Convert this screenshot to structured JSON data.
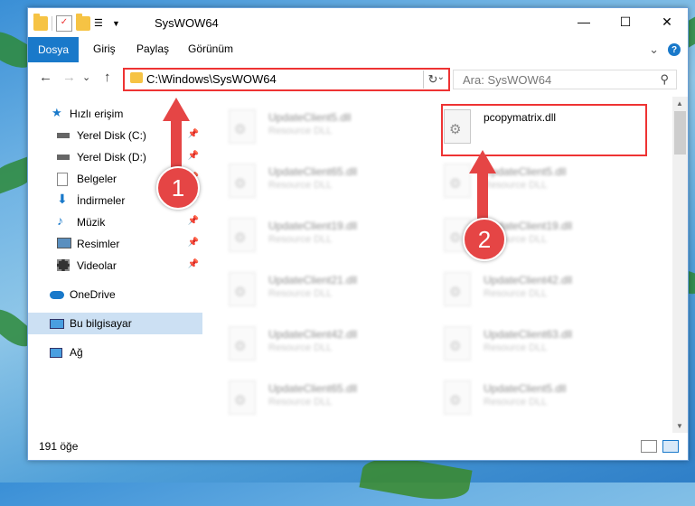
{
  "window": {
    "title": "SysWOW64",
    "min": "—",
    "max": "☐",
    "close": "✕"
  },
  "ribbon": {
    "tabs": [
      "Dosya",
      "Giriş",
      "Paylaş",
      "Görünüm"
    ],
    "expand": "⌄",
    "help": "?"
  },
  "nav": {
    "back": "←",
    "forward": "→",
    "history": "⌄",
    "up": "↑",
    "address": "C:\\Windows\\SysWOW64",
    "refresh": "↻",
    "search_placeholder": "Ara: SysWOW64",
    "search_icon": "⚲"
  },
  "sidebar": {
    "items": [
      {
        "label": "Hızlı erişim",
        "icon": "star-icon",
        "pinned": false
      },
      {
        "label": "Yerel Disk (C:)",
        "icon": "drive-icon",
        "pinned": true
      },
      {
        "label": "Yerel Disk (D:)",
        "icon": "drive-icon",
        "pinned": true
      },
      {
        "label": "Belgeler",
        "icon": "documents-icon",
        "pinned": true
      },
      {
        "label": "İndirmeler",
        "icon": "download-icon",
        "pinned": true
      },
      {
        "label": "Müzik",
        "icon": "music-icon",
        "pinned": true
      },
      {
        "label": "Resimler",
        "icon": "pictures-icon",
        "pinned": true
      },
      {
        "label": "Videolar",
        "icon": "videos-icon",
        "pinned": true
      },
      {
        "label": "OneDrive",
        "icon": "onedrive-icon",
        "pinned": false
      },
      {
        "label": "Bu bilgisayar",
        "icon": "computer-icon",
        "pinned": false
      },
      {
        "label": "Ağ",
        "icon": "network-icon",
        "pinned": false
      }
    ],
    "pin_glyph": "📌"
  },
  "files_left": [
    {
      "name": "UpdateClient5.dll",
      "type": "Resource DLL"
    },
    {
      "name": "UpdateClient65.dll",
      "type": "Resource DLL"
    },
    {
      "name": "UpdateClient19.dll",
      "type": "Resource DLL"
    },
    {
      "name": "UpdateClient21.dll",
      "type": "Resource DLL"
    },
    {
      "name": "UpdateClient42.dll",
      "type": "Resource DLL"
    },
    {
      "name": "UpdateClient65.dll",
      "type": "Resource DLL"
    }
  ],
  "files_right": [
    {
      "name": "pcopymatrix.dll",
      "type": ""
    },
    {
      "name": "UpdateClient5.dll",
      "type": "Resource DLL"
    },
    {
      "name": "UpdateClient19.dll",
      "type": "Resource DLL"
    },
    {
      "name": "UpdateClient42.dll",
      "type": "Resource DLL"
    },
    {
      "name": "UpdateClient63.dll",
      "type": "Resource DLL"
    },
    {
      "name": "UpdateClient5.dll",
      "type": "Resource DLL"
    }
  ],
  "status": {
    "count": "191 öğe"
  },
  "callouts": {
    "one": "1",
    "two": "2"
  },
  "colors": {
    "accent": "#1979ca",
    "highlight": "#e54545"
  }
}
